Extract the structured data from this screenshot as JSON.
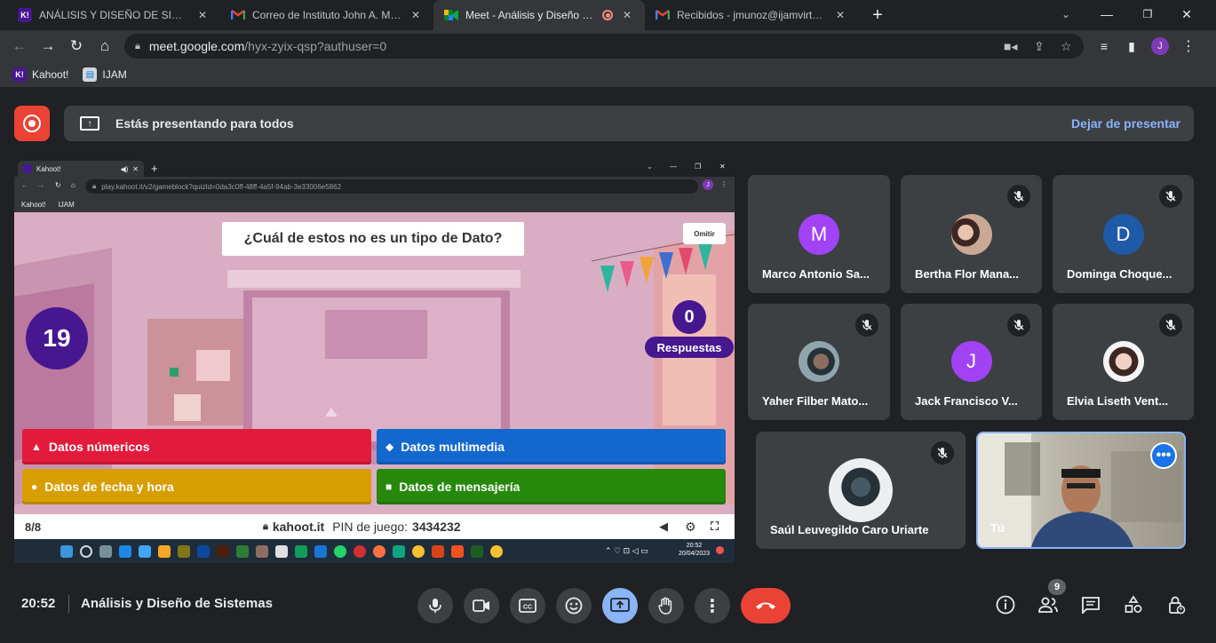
{
  "browser": {
    "tabs": [
      {
        "favicon": "kahoot-icon",
        "title": "ANÁLISIS Y DISEÑO DE SISTEMAS",
        "active": false
      },
      {
        "favicon": "gmail-icon",
        "title": "Correo de Instituto John A. Mackay",
        "active": false
      },
      {
        "favicon": "meet-icon",
        "title": "Meet - Análisis y Diseño de Sistemas",
        "active": true
      },
      {
        "favicon": "gmail-icon",
        "title": "Recibidos - jmunoz@ijamvirtual.edu.pe",
        "active": false
      }
    ],
    "url_host": "meet.google.com",
    "url_path": "/hyx-zyix-qsp?authuser=0",
    "profile_initial": "J",
    "bookmarks": [
      {
        "icon": "kahoot-icon",
        "label": "Kahoot!"
      },
      {
        "icon": "page-icon",
        "label": "IJAM"
      }
    ]
  },
  "meet": {
    "presenting_text": "Estás presentando para todos",
    "stop_presenting": "Dejar de presentar",
    "time": "20:52",
    "meeting_title": "Análisis y Diseño de Sistemas",
    "people_count": "9",
    "colors": {
      "accent": "#8ab4f8",
      "end_call": "#ea4335",
      "present_active": "#8ab4f8"
    }
  },
  "shared": {
    "tab_title": "Kahoot!",
    "url": "play.kahoot.it/v2/gameblock?quizId=0da3c0ff-48ff-4a5f-94ab-3e33006e5862",
    "bookmarks": [
      "Kahoot!",
      "IJAM"
    ],
    "question": "¿Cuál de estos no es un tipo de Dato?",
    "skip_label": "Omitir",
    "timer": "19",
    "answers_count": "0",
    "answers_label": "Respuestas",
    "answers": [
      {
        "shape": "▲",
        "label": "Datos númericos",
        "color": "#e21b3c"
      },
      {
        "shape": "◆",
        "label": "Datos multimedia",
        "color": "#1368ce"
      },
      {
        "shape": "●",
        "label": "Datos de fecha y hora",
        "color": "#d89e00"
      },
      {
        "shape": "■",
        "label": "Datos de mensajería",
        "color": "#26890c"
      }
    ],
    "progress": "8/8",
    "brand": "kahoot.it",
    "pin_label": "PIN de juego:",
    "pin": "3434232",
    "taskbar_time": "20:52",
    "taskbar_date": "20/04/2023"
  },
  "participants": [
    {
      "name": "Marco Antonio Sa...",
      "initial": "M",
      "avatar_color": "#a142f4",
      "photo": false,
      "muted": false
    },
    {
      "name": "Bertha Flor Mana...",
      "initial": "",
      "avatar_color": "#8d6e63",
      "photo": true,
      "muted": true
    },
    {
      "name": "Dominga Choque...",
      "initial": "D",
      "avatar_color": "#1e5aa8",
      "photo": false,
      "muted": true
    },
    {
      "name": "Yaher Filber Mato...",
      "initial": "",
      "avatar_color": "#5f6368",
      "photo": true,
      "muted": true
    },
    {
      "name": "Jack Francisco V...",
      "initial": "J",
      "avatar_color": "#a142f4",
      "photo": false,
      "muted": true
    },
    {
      "name": "Elvia Liseth Vent...",
      "initial": "",
      "avatar_color": "#795548",
      "photo": true,
      "muted": true
    },
    {
      "name": "Saúl Leuvegildo Caro Uriarte",
      "initial": "",
      "avatar_color": "#37474f",
      "photo": true,
      "muted": true
    }
  ],
  "self_tile": {
    "name": "Tú"
  }
}
